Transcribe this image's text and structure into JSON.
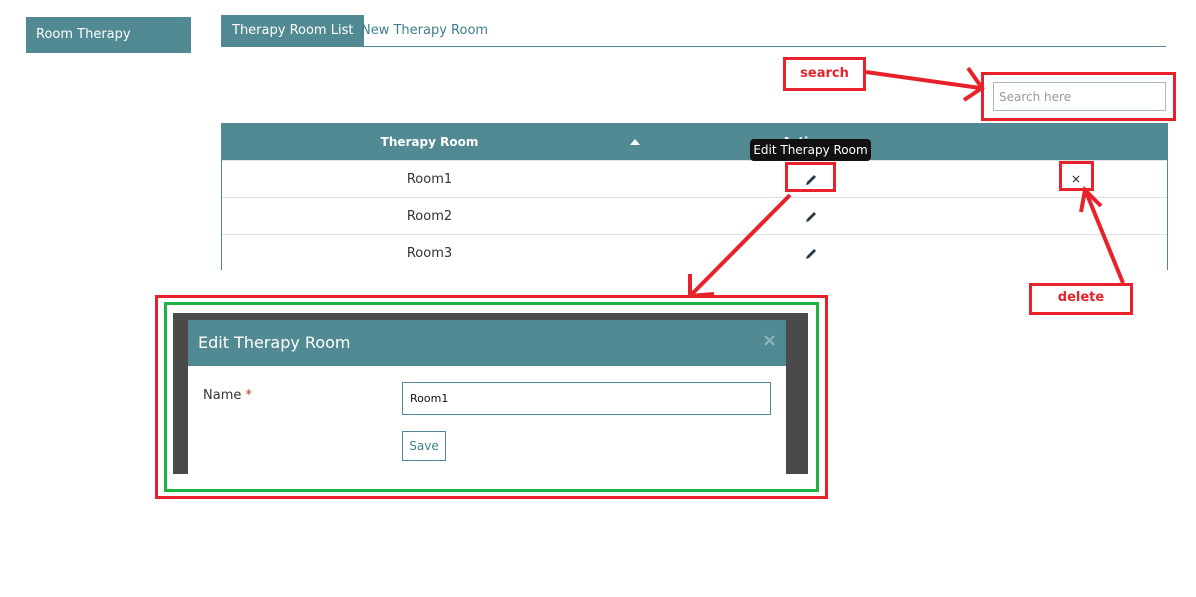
{
  "sidebar": {
    "items": [
      {
        "label": "Room Therapy"
      }
    ]
  },
  "tabs": [
    {
      "label": "Therapy Room List",
      "active": true
    },
    {
      "label": "New Therapy Room",
      "active": false
    }
  ],
  "search": {
    "placeholder": "Search here",
    "value": ""
  },
  "table": {
    "headers": {
      "room": "Therapy Room",
      "action": "Action"
    },
    "rows": [
      {
        "room": "Room1"
      },
      {
        "room": "Room2"
      },
      {
        "room": "Room3"
      }
    ]
  },
  "tooltip": {
    "text": "Edit Therapy Room"
  },
  "annotations": {
    "search": "search",
    "delete": "delete"
  },
  "modal": {
    "title": "Edit Therapy Room",
    "close": "×",
    "name_label": "Name",
    "required_mark": "*",
    "name_value": "Room1",
    "save_label": "Save"
  },
  "delete_icon": {
    "glyph": "×"
  },
  "colors": {
    "primary": "#528a93",
    "annotation_red": "#e8222b",
    "annotation_green": "#1fb141"
  }
}
